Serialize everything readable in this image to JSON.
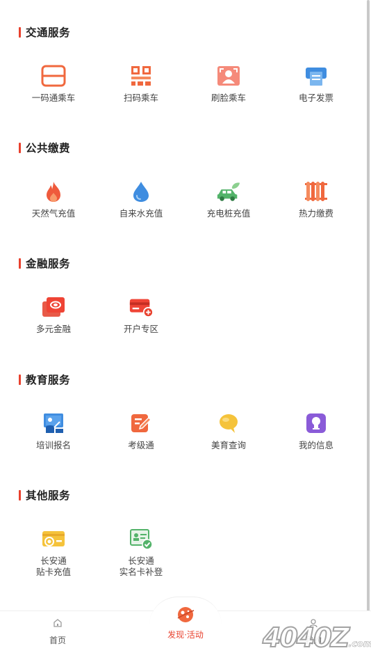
{
  "sections": [
    {
      "title": "交通服务",
      "items": [
        {
          "label": "一码通乘车",
          "icon": "qr-scan-frame-icon"
        },
        {
          "label": "扫码乘车",
          "icon": "qr-code-icon"
        },
        {
          "label": "刷脸乘车",
          "icon": "face-scan-icon"
        },
        {
          "label": "电子发票",
          "icon": "invoice-printer-icon"
        }
      ]
    },
    {
      "title": "公共缴费",
      "items": [
        {
          "label": "天然气充值",
          "icon": "flame-icon"
        },
        {
          "label": "自来水充值",
          "icon": "water-drop-icon"
        },
        {
          "label": "充电桩充值",
          "icon": "electric-car-icon"
        },
        {
          "label": "热力缴费",
          "icon": "radiator-icon"
        }
      ]
    },
    {
      "title": "金融服务",
      "items": [
        {
          "label": "多元金融",
          "icon": "finance-cards-icon"
        },
        {
          "label": "开户专区",
          "icon": "add-card-icon"
        }
      ]
    },
    {
      "title": "教育服务",
      "items": [
        {
          "label": "培训报名",
          "icon": "blackboard-teacher-icon"
        },
        {
          "label": "考级通",
          "icon": "edit-pencil-icon"
        },
        {
          "label": "美育查询",
          "icon": "chat-bubble-icon"
        },
        {
          "label": "我的信息",
          "icon": "user-profile-icon"
        }
      ]
    },
    {
      "title": "其他服务",
      "items": [
        {
          "label_line1": "长安通",
          "label_line2": "贴卡充值",
          "icon": "card-topup-icon"
        },
        {
          "label_line1": "长安通",
          "label_line2": "实名卡补登",
          "icon": "id-card-verified-icon"
        }
      ]
    }
  ],
  "tabbar": {
    "home": "首页",
    "discover": "发现·活动",
    "mine": "我的"
  },
  "colors": {
    "accent": "#e8412e",
    "icon_orange": "#f0683e",
    "icon_blue": "#3f8de0",
    "icon_green": "#53b36a",
    "icon_yellow": "#f5c33b",
    "icon_purple": "#8a5bd8"
  },
  "watermark": {
    "main": "4040Z",
    "domain": ".com"
  }
}
